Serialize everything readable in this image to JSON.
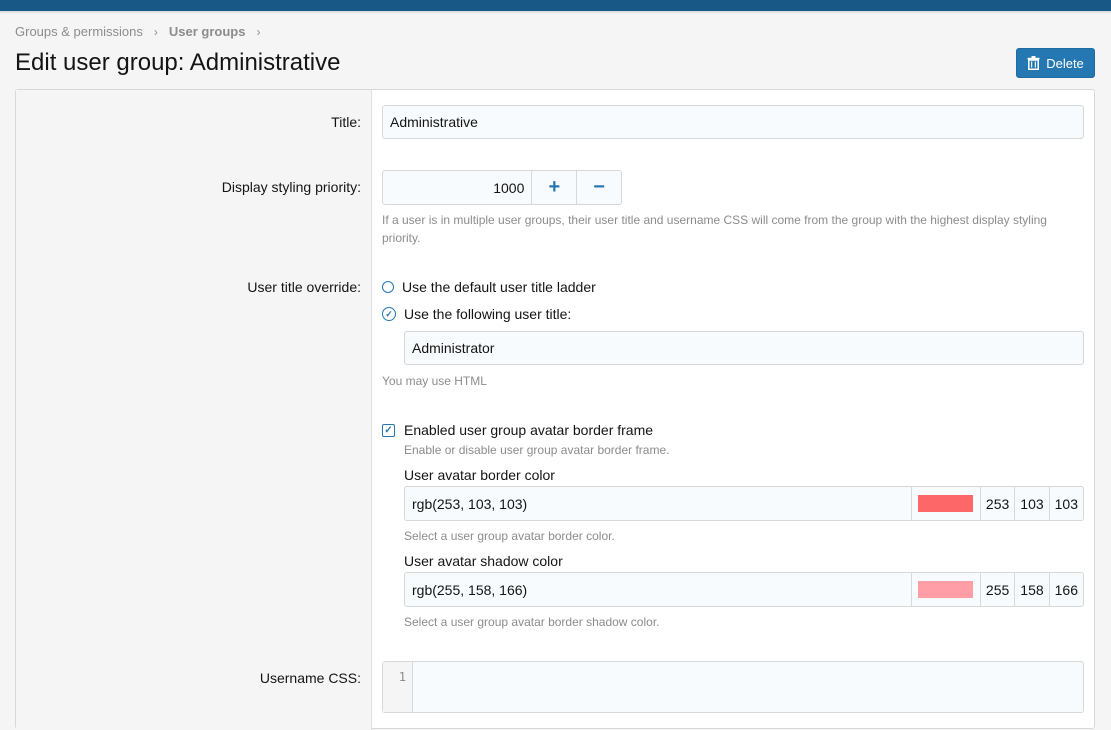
{
  "breadcrumb": {
    "items": [
      "Groups & permissions",
      "User groups"
    ]
  },
  "page": {
    "title": "Edit user group: Administrative",
    "delete_label": "Delete"
  },
  "form": {
    "title": {
      "label": "Title:",
      "value": "Administrative"
    },
    "priority": {
      "label": "Display styling priority:",
      "value": "1000",
      "plus": "+",
      "minus": "−",
      "hint": "If a user is in multiple user groups, their user title and username CSS will come from the group with the highest display styling priority."
    },
    "user_title_override": {
      "label": "User title override:",
      "option_default": "Use the default user title ladder",
      "option_custom": "Use the following user title:",
      "custom_value": "Administrator",
      "hint": "You may use HTML",
      "selected": "custom"
    },
    "avatar_frame": {
      "checkbox_label": "Enabled user group avatar border frame",
      "checked": true,
      "checkbox_hint": "Enable or disable user group avatar border frame.",
      "border_color": {
        "label": "User avatar border color",
        "value": "rgb(253, 103, 103)",
        "r": "253",
        "g": "103",
        "b": "103",
        "swatch": "#fd6767",
        "hint": "Select a user group avatar border color."
      },
      "shadow_color": {
        "label": "User avatar shadow color",
        "value": "rgb(255, 158, 166)",
        "r": "255",
        "g": "158",
        "b": "166",
        "swatch": "#ff9ea6",
        "hint": "Select a user group avatar border shadow color."
      }
    },
    "username_css": {
      "label": "Username CSS:",
      "line_number": "1",
      "value": ""
    }
  },
  "colors": {
    "accent": "#2577b1",
    "topbar": "#185886"
  }
}
